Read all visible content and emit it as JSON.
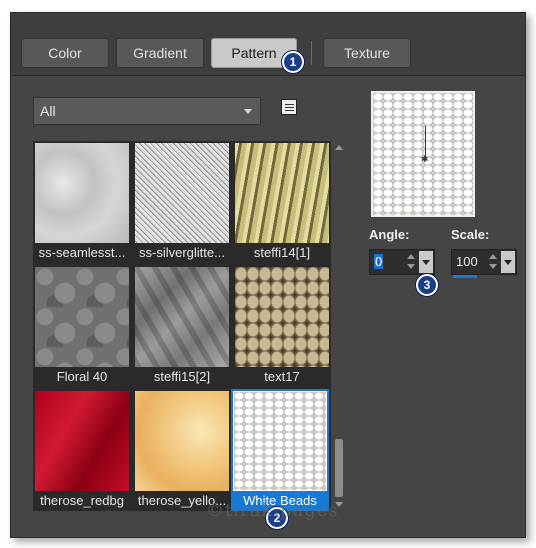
{
  "tabs": [
    {
      "label": "Color",
      "active": false
    },
    {
      "label": "Gradient",
      "active": false
    },
    {
      "label": "Pattern",
      "active": true
    },
    {
      "label": "Texture",
      "active": false
    }
  ],
  "badges": {
    "one": "1",
    "two": "2",
    "three": "3"
  },
  "category_select": {
    "value": "All"
  },
  "view_icon": "list-view-icon",
  "patterns": [
    {
      "label": "ss-seamlesst...",
      "selected": false
    },
    {
      "label": "ss-silverglitte...",
      "selected": false
    },
    {
      "label": "steffi14[1]",
      "selected": false
    },
    {
      "label": "Floral 40",
      "selected": false
    },
    {
      "label": "steffi15[2]",
      "selected": false
    },
    {
      "label": "text17",
      "selected": false
    },
    {
      "label": "therose_redbg",
      "selected": false
    },
    {
      "label": "therose_yello...",
      "selected": false
    },
    {
      "label": "White Beads",
      "selected": true
    }
  ],
  "angle": {
    "label": "Angle:",
    "value": "0"
  },
  "scale": {
    "label": "Scale:",
    "value": "100"
  },
  "watermark": "©tirak.pages",
  "colors": {
    "accent": "#1679d6",
    "badge": "#1c3e8a",
    "panel": "#454545"
  }
}
